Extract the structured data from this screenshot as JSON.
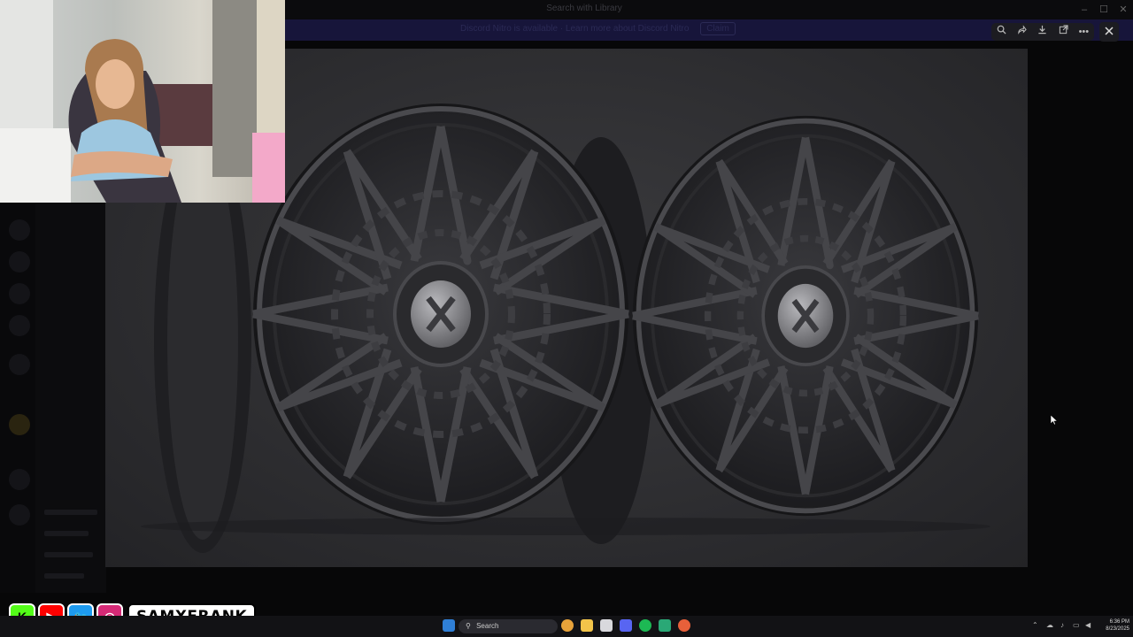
{
  "window": {
    "title": "Search with Library"
  },
  "banner": {
    "text": "Discord Nitro is available · Learn more about Discord Nitro",
    "action": "Claim"
  },
  "toolbar": {
    "zoom_icon": "zoom-in-icon",
    "forward_icon": "share-forward-icon",
    "download_icon": "download-icon",
    "open_icon": "open-external-icon",
    "more_icon": "more-icon",
    "close_icon": "close-icon"
  },
  "overlay": {
    "social_icons": [
      "K",
      "▶",
      "🐦",
      "◎"
    ],
    "handle": "SAMXFRANK"
  },
  "taskbar": {
    "search_placeholder": "Search",
    "time": "6:36 PM",
    "date": "8/23/2025"
  },
  "colors": {
    "accent": "#5865f2",
    "nitro_banner": "#17153a"
  }
}
